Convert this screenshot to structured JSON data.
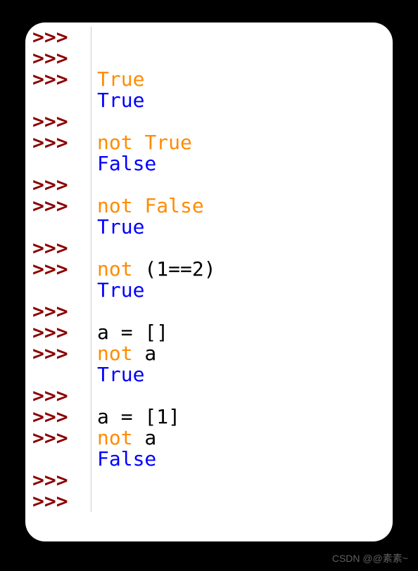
{
  "prompt": ">>>",
  "lines": [
    {
      "prompt": true,
      "tokens": []
    },
    {
      "prompt": true,
      "tokens": []
    },
    {
      "prompt": true,
      "tokens": [
        {
          "t": "True",
          "c": "kw-orange"
        }
      ]
    },
    {
      "prompt": false,
      "tokens": [
        {
          "t": "True",
          "c": "kw-blue"
        }
      ]
    },
    {
      "prompt": true,
      "tokens": []
    },
    {
      "prompt": true,
      "tokens": [
        {
          "t": "not",
          "c": "kw-orange"
        },
        {
          "t": " ",
          "c": "kw-black"
        },
        {
          "t": "True",
          "c": "kw-orange"
        }
      ]
    },
    {
      "prompt": false,
      "tokens": [
        {
          "t": "False",
          "c": "kw-blue"
        }
      ]
    },
    {
      "prompt": true,
      "tokens": []
    },
    {
      "prompt": true,
      "tokens": [
        {
          "t": "not",
          "c": "kw-orange"
        },
        {
          "t": " ",
          "c": "kw-black"
        },
        {
          "t": "False",
          "c": "kw-orange"
        }
      ]
    },
    {
      "prompt": false,
      "tokens": [
        {
          "t": "True",
          "c": "kw-blue"
        }
      ]
    },
    {
      "prompt": true,
      "tokens": []
    },
    {
      "prompt": true,
      "tokens": [
        {
          "t": "not",
          "c": "kw-orange"
        },
        {
          "t": " (",
          "c": "kw-black"
        },
        {
          "t": "1",
          "c": "kw-black"
        },
        {
          "t": "==",
          "c": "kw-black"
        },
        {
          "t": "2",
          "c": "kw-black"
        },
        {
          "t": ")",
          "c": "kw-black"
        }
      ]
    },
    {
      "prompt": false,
      "tokens": [
        {
          "t": "True",
          "c": "kw-blue"
        }
      ]
    },
    {
      "prompt": true,
      "tokens": []
    },
    {
      "prompt": true,
      "tokens": [
        {
          "t": "a = []",
          "c": "kw-black"
        }
      ]
    },
    {
      "prompt": true,
      "tokens": [
        {
          "t": "not",
          "c": "kw-orange"
        },
        {
          "t": " a",
          "c": "kw-black"
        }
      ]
    },
    {
      "prompt": false,
      "tokens": [
        {
          "t": "True",
          "c": "kw-blue"
        }
      ]
    },
    {
      "prompt": true,
      "tokens": []
    },
    {
      "prompt": true,
      "tokens": [
        {
          "t": "a = [",
          "c": "kw-black"
        },
        {
          "t": "1",
          "c": "kw-black"
        },
        {
          "t": "]",
          "c": "kw-black"
        }
      ]
    },
    {
      "prompt": true,
      "tokens": [
        {
          "t": "not",
          "c": "kw-orange"
        },
        {
          "t": " a",
          "c": "kw-black"
        }
      ]
    },
    {
      "prompt": false,
      "tokens": [
        {
          "t": "False",
          "c": "kw-blue"
        }
      ]
    },
    {
      "prompt": true,
      "tokens": []
    },
    {
      "prompt": true,
      "tokens": []
    }
  ],
  "watermark": "CSDN @@素素~"
}
